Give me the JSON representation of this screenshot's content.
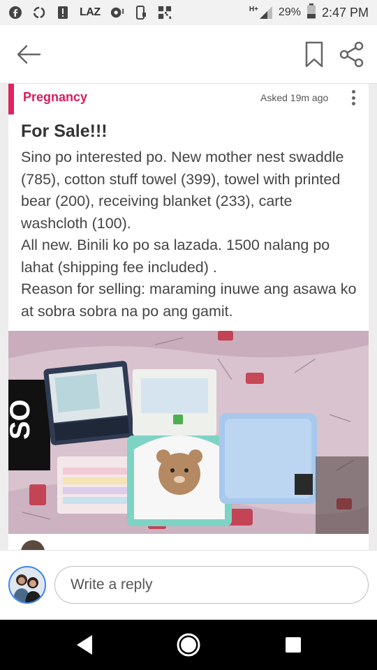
{
  "status_bar": {
    "icons_left": [
      "facebook-icon",
      "sync-icon",
      "alert-icon",
      "laz-icon",
      "record-icon",
      "phone-icon",
      "qr-icon"
    ],
    "laz_text": "LAZ",
    "signal_label": "H+",
    "battery": "29%",
    "time": "2:47 PM"
  },
  "app_bar": {
    "back_icon": "arrow-left-icon",
    "bookmark_icon": "bookmark-icon",
    "share_icon": "share-icon"
  },
  "post": {
    "category": "Pregnancy",
    "asked": "Asked 19m ago",
    "title": "For Sale!!!",
    "body": "Sino po interested po. New mother nest swaddle (785), cotton stuff towel (399), towel with printed bear (200), receiving blanket (233), carte washcloth (100).\nAll new. Binili ko po sa lazada. 1500 nalang po lahat (shipping fee included) .\nReason for selling: maraming inuwe ang asawa  ko at sobra sobra na po ang gamit.",
    "accent_color": "#e0245e"
  },
  "reply": {
    "placeholder": "Write a reply"
  },
  "nav": {
    "icons": [
      "back-triangle-icon",
      "home-circle-icon",
      "recents-square-icon"
    ]
  }
}
